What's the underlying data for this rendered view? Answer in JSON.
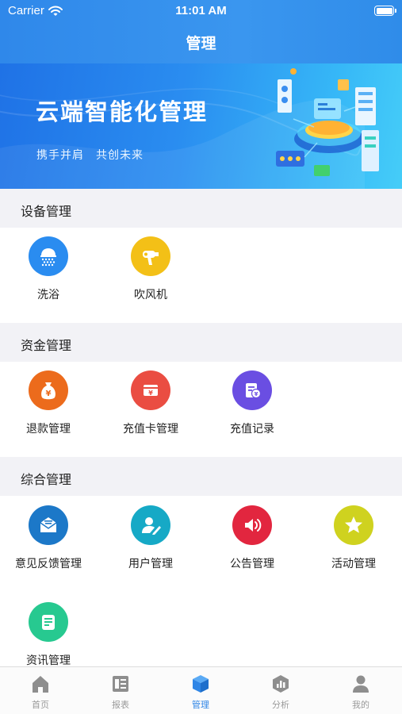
{
  "status_bar": {
    "carrier": "Carrier",
    "time": "11:01 AM"
  },
  "nav": {
    "title": "管理"
  },
  "banner": {
    "title": "云端智能化管理",
    "subtitle": "携手并肩　共创未来"
  },
  "sections": [
    {
      "title": "设备管理",
      "items": [
        {
          "label": "洗浴",
          "icon": "shower-icon",
          "color": "#2a8cf0"
        },
        {
          "label": "吹风机",
          "icon": "hair-dryer-icon",
          "color": "#f3c017"
        }
      ]
    },
    {
      "title": "资金管理",
      "items": [
        {
          "label": "退款管理",
          "icon": "money-bag-icon",
          "color": "#ec6b1c"
        },
        {
          "label": "充值卡管理",
          "icon": "card-yen-icon",
          "color": "#ea4d42"
        },
        {
          "label": "充值记录",
          "icon": "record-yen-icon",
          "color": "#6a4ee2"
        }
      ]
    },
    {
      "title": "综合管理",
      "items": [
        {
          "label": "意见反馈管理",
          "icon": "mail-icon",
          "color": "#1c78c8"
        },
        {
          "label": "用户管理",
          "icon": "user-edit-icon",
          "color": "#16a9c6"
        },
        {
          "label": "公告管理",
          "icon": "speaker-icon",
          "color": "#e2263f"
        },
        {
          "label": "活动管理",
          "icon": "star-icon",
          "color": "#cfd21f"
        },
        {
          "label": "资讯管理",
          "icon": "news-icon",
          "color": "#27c990"
        }
      ]
    }
  ],
  "tabbar": [
    {
      "label": "首页",
      "icon": "home-icon",
      "active": false
    },
    {
      "label": "报表",
      "icon": "report-icon",
      "active": false
    },
    {
      "label": "管理",
      "icon": "cube-icon",
      "active": true
    },
    {
      "label": "分析",
      "icon": "analysis-icon",
      "active": false
    },
    {
      "label": "我的",
      "icon": "profile-icon",
      "active": false
    }
  ],
  "colors": {
    "primary": "#2f86e6",
    "section_bg": "#f2f2f6",
    "tab_inactive": "#9a9a9a"
  }
}
